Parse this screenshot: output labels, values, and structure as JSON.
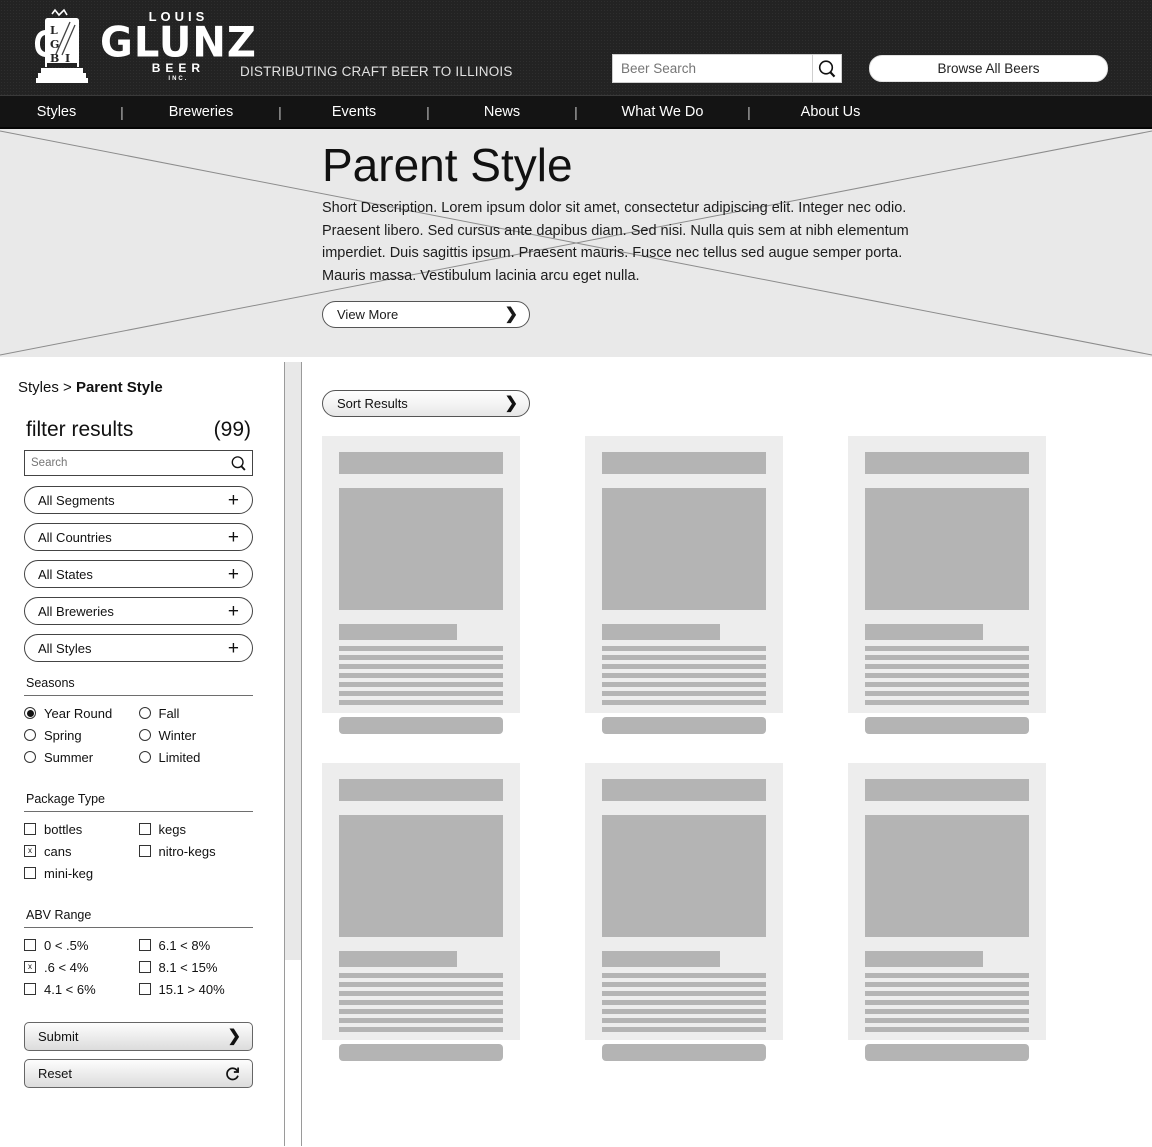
{
  "header": {
    "logo": {
      "monogram": "LGBI",
      "line1": "LOUIS",
      "line2": "GLUNZ",
      "line3": "BEER",
      "line4": "INC."
    },
    "tagline": "DISTRIBUTING CRAFT BEER TO ILLINOIS",
    "search": {
      "placeholder": "Beer Search",
      "value": "",
      "icon": "search-icon"
    },
    "browse_label": "Browse All Beers"
  },
  "nav": {
    "items": [
      {
        "label": "Styles"
      },
      {
        "label": "Breweries"
      },
      {
        "label": "Events"
      },
      {
        "label": "News"
      },
      {
        "label": "What We Do"
      },
      {
        "label": "About Us"
      }
    ],
    "separator": "|"
  },
  "hero": {
    "title": "Parent Style",
    "description": "Short Description. Lorem ipsum dolor sit amet, consectetur adipiscing elit. Integer nec odio. Praesent libero. Sed cursus ante dapibus diam. Sed nisi. Nulla quis sem at nibh elementum imperdiet. Duis sagittis ipsum. Praesent mauris. Fusce nec tellus sed augue semper porta. Mauris massa. Vestibulum lacinia arcu eget nulla.",
    "view_more_label": "View More",
    "chevron": "❯"
  },
  "sidebar": {
    "breadcrumb_parent": "Styles > ",
    "breadcrumb_current": "Parent Style",
    "filter_title": "filter results",
    "filter_count": "(99)",
    "search": {
      "placeholder": "Search",
      "value": "",
      "icon": "search-icon"
    },
    "dropdowns": [
      {
        "label": "All Segments",
        "expand": "+"
      },
      {
        "label": "All Countries",
        "expand": "+"
      },
      {
        "label": "All States",
        "expand": "+"
      },
      {
        "label": "All Breweries",
        "expand": "+"
      },
      {
        "label": "All Styles",
        "expand": "+"
      }
    ],
    "seasons": {
      "label": "Seasons",
      "col1": [
        {
          "label": "Year Round",
          "selected": true
        },
        {
          "label": "Spring",
          "selected": false
        },
        {
          "label": "Summer",
          "selected": false
        }
      ],
      "col2": [
        {
          "label": "Fall",
          "selected": false
        },
        {
          "label": "Winter",
          "selected": false
        },
        {
          "label": "Limited",
          "selected": false
        }
      ]
    },
    "package_type": {
      "label": "Package Type",
      "col1": [
        {
          "label": "bottles",
          "checked": false
        },
        {
          "label": "cans",
          "checked": true
        },
        {
          "label": "mini-keg",
          "checked": false
        }
      ],
      "col2": [
        {
          "label": "kegs",
          "checked": false
        },
        {
          "label": "nitro-kegs",
          "checked": false
        }
      ]
    },
    "abv_range": {
      "label": "ABV Range",
      "col1": [
        {
          "label": "0 < .5%",
          "checked": false
        },
        {
          "label": ".6 < 4%",
          "checked": true
        },
        {
          "label": "4.1 < 6%",
          "checked": false
        }
      ],
      "col2": [
        {
          "label": "6.1 < 8%",
          "checked": false
        },
        {
          "label": "8.1 < 15%",
          "checked": false
        },
        {
          "label": "15.1 > 40%",
          "checked": false
        }
      ]
    },
    "submit_label": "Submit",
    "submit_icon": "❯",
    "reset_label": "Reset",
    "reset_icon": "reset-icon",
    "checkmark": "x"
  },
  "results": {
    "sort_label": "Sort Results",
    "sort_chevron": "❯",
    "card_count": 6,
    "text_line_count": 7
  },
  "colors": {
    "header_bg": "#232323",
    "nav_bg": "#141414",
    "hero_bg": "#e9e9e9",
    "card_bg": "#ededed",
    "placeholder": "#b4b4b4"
  }
}
